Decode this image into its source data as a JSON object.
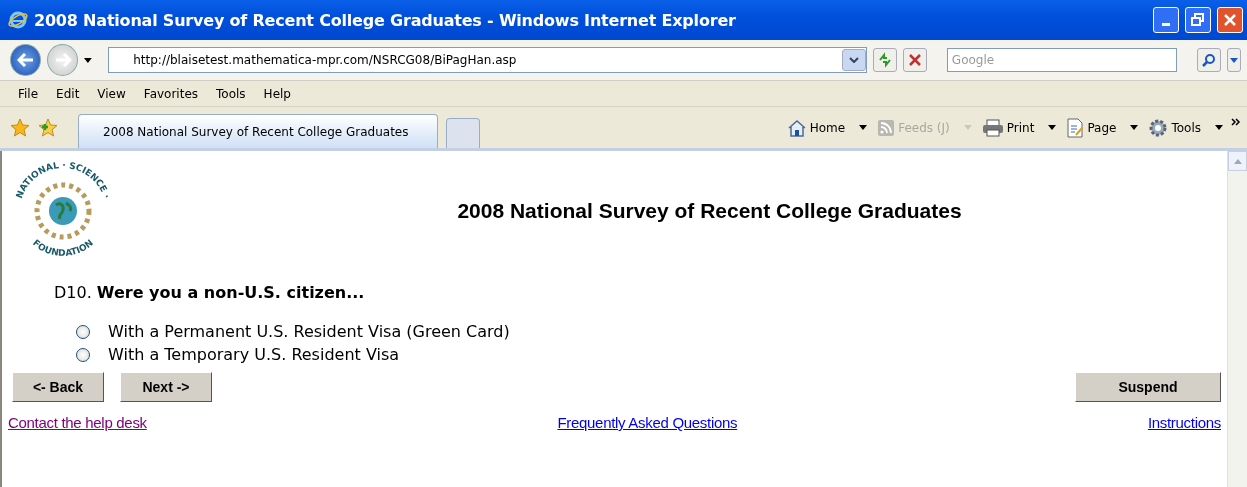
{
  "window": {
    "title": "2008 National Survey of Recent College Graduates - Windows Internet Explorer"
  },
  "address_bar": {
    "url": "http://blaisetest.mathematica-mpr.com/NSRCG08/BiPagHan.asp"
  },
  "search": {
    "placeholder": "Google"
  },
  "menu": [
    "File",
    "Edit",
    "View",
    "Favorites",
    "Tools",
    "Help"
  ],
  "tabs": [
    {
      "label": "2008 National Survey of Recent College Graduates",
      "selected": true
    }
  ],
  "command_bar": [
    {
      "label": "Home",
      "kind": "home",
      "disabled": false
    },
    {
      "label": "Feeds (J)",
      "kind": "feeds",
      "disabled": true
    },
    {
      "label": "Print",
      "kind": "print",
      "disabled": false
    },
    {
      "label": "Page",
      "kind": "page",
      "disabled": false
    },
    {
      "label": "Tools",
      "kind": "tools",
      "disabled": false
    }
  ],
  "logo": {
    "top": "NATIONAL · SCIENCE ·",
    "bottom": "FOUNDATION"
  },
  "page": {
    "heading": "2008 National Survey of Recent College Graduates",
    "question": {
      "number": "D10.",
      "text": "Were you a non-U.S. citizen..."
    },
    "options": [
      {
        "label": "With a Permanent U.S. Resident Visa (Green Card)",
        "selected": false
      },
      {
        "label": "With a Temporary U.S. Resident Visa",
        "selected": false
      }
    ],
    "buttons": {
      "back": "<- Back",
      "next": "Next ->",
      "suspend": "Suspend"
    },
    "links": [
      {
        "label": "Contact the help desk",
        "visited": true
      },
      {
        "label": "Frequently Asked Questions",
        "visited": false
      },
      {
        "label": "Instructions",
        "visited": false
      }
    ]
  }
}
